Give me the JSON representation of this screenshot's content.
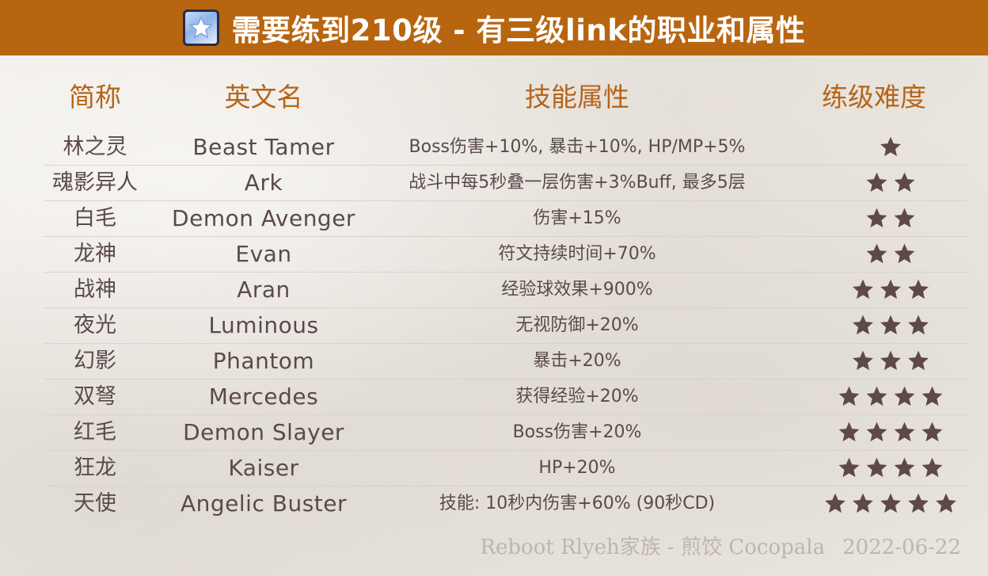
{
  "banner": {
    "title": "需要练到210级 - 有三级link的职业和属性",
    "icon": "star-badge-icon"
  },
  "table": {
    "headers": [
      "简称",
      "英文名",
      "技能属性",
      "练级难度"
    ],
    "rows": [
      {
        "short": "林之灵",
        "english": "Beast Tamer",
        "skill": "Boss伤害+10%, 暴击+10%, HP/MP+5%",
        "difficulty": 1
      },
      {
        "short": "魂影异人",
        "english": "Ark",
        "skill": "战斗中每5秒叠一层伤害+3%Buff, 最多5层",
        "difficulty": 2
      },
      {
        "short": "白毛",
        "english": "Demon Avenger",
        "skill": "伤害+15%",
        "difficulty": 2
      },
      {
        "short": "龙神",
        "english": "Evan",
        "skill": "符文持续时间+70%",
        "difficulty": 2
      },
      {
        "short": "战神",
        "english": "Aran",
        "skill": "经验球效果+900%",
        "difficulty": 3
      },
      {
        "short": "夜光",
        "english": "Luminous",
        "skill": "无视防御+20%",
        "difficulty": 3
      },
      {
        "short": "幻影",
        "english": "Phantom",
        "skill": "暴击+20%",
        "difficulty": 3
      },
      {
        "short": "双弩",
        "english": "Mercedes",
        "skill": "获得经验+20%",
        "difficulty": 4
      },
      {
        "short": "红毛",
        "english": "Demon Slayer",
        "skill": "Boss伤害+20%",
        "difficulty": 4
      },
      {
        "short": "狂龙",
        "english": "Kaiser",
        "skill": "HP+20%",
        "difficulty": 4
      },
      {
        "short": "天使",
        "english": "Angelic Buster",
        "skill": "技能: 10秒内伤害+60% (90秒CD)",
        "difficulty": 5
      }
    ]
  },
  "footer": {
    "credit": "Reboot Rlyeh家族 - 煎饺 Cocopala",
    "date": "2022-06-22"
  },
  "colors": {
    "banner": "#b8650f",
    "header_text": "#b5651a",
    "body_text": "#5a4a4a",
    "star": "#5e4848",
    "footer_text": "#bdb6ae"
  }
}
